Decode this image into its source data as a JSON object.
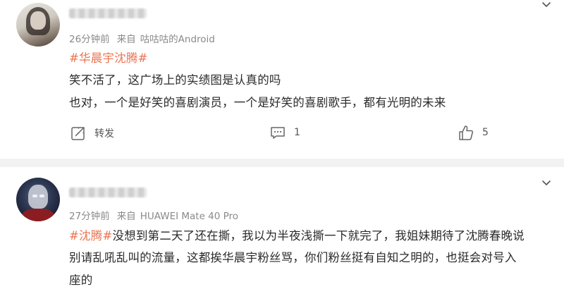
{
  "posts": [
    {
      "time": "26分钟前",
      "source_prefix": "来自",
      "device": "咕咕咕的Android",
      "lines": [
        {
          "topic": "#华晨宇沈腾#",
          "text": ""
        },
        {
          "topic": "",
          "text": "笑不活了，这广场上的实绩图是认真的吗"
        },
        {
          "topic": "",
          "text": "也对，一个是好笑的喜剧演员，一个是好笑的喜剧歌手，都有光明的未来"
        }
      ],
      "actions": {
        "repost_label": "转发",
        "comment_count": "1",
        "like_count": "5"
      }
    },
    {
      "time": "27分钟前",
      "source_prefix": "来自",
      "device": "HUAWEI Mate 40 Pro",
      "lines": [
        {
          "topic": "#沈腾#",
          "text": "没想到第二天了还在撕，我以为半夜浅撕一下就完了，我姐妹期待了沈腾春晚说"
        },
        {
          "topic": "",
          "text": "别请乱吼乱叫的流量，这都挨华晨宇粉丝骂，你们粉丝挺有自知之明的，也挺会对号入"
        },
        {
          "topic": "",
          "text": "座的"
        }
      ]
    }
  ],
  "colors": {
    "topic": "#eb7350",
    "meta": "#8a8a8a",
    "text": "#2a2a2a",
    "divider": "#f2f2f2"
  },
  "icons": [
    "chevron-down-icon",
    "repost-icon",
    "comment-icon",
    "like-icon"
  ]
}
